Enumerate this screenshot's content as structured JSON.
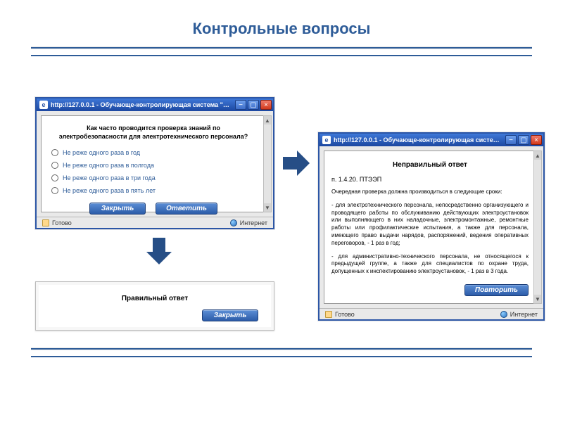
{
  "page_title": "Контрольные вопросы",
  "window_question": {
    "titlebar": "http://127.0.0.1 - Обучающе-контролирующая система \"ОЛИМП:ОКС\" Вопро...",
    "question": "Как часто проводится проверка знаний по электробезопасности для электротехнического персонала?",
    "options": [
      "Не реже одного раза в год",
      "Не реже одного раза в полгода",
      "Не реже одного раза в три года",
      "Не реже одного раза в пять лет"
    ],
    "btn_close": "Закрыть",
    "btn_answer": "Ответить",
    "status_left": "Готово",
    "status_right": "Интернет"
  },
  "correct_box": {
    "title": "Правильный ответ",
    "btn_close": "Закрыть"
  },
  "window_wrong": {
    "titlebar": "http://127.0.0.1 - Обучающе-контролирующая система \"ОЛИМП:ОКС\" Вопро...",
    "title": "Неправильный ответ",
    "source_ref": "п. 1.4.20. ПТЭЭП",
    "intro": "Очередная проверка должна производиться в следующие сроки:",
    "p1": "- для электротехнического персонала, непосредственно организующего и проводящего работы по обслуживанию действующих электроустановок или выполняющего в них наладочные, электромонтажные, ремонтные работы или профилактические испытания, а также для персонала, имеющего право выдачи нарядов, распоряжений, ведения оперативных переговоров, - 1 раз в год;",
    "p2": "- для административно-технического персонала, не относящегося к предыдущей группе, а также для специалистов по охране труда, допущенных к инспектированию электроустановок, - 1 раз в 3 года.",
    "btn_repeat": "Повторить",
    "status_left": "Готово",
    "status_right": "Интернет"
  }
}
